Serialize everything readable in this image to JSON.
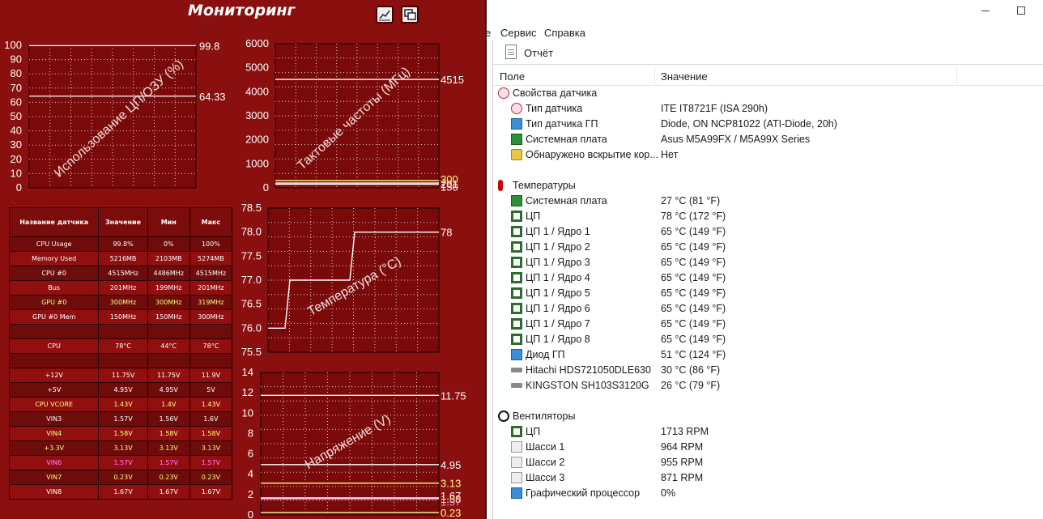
{
  "monitor": {
    "title": "Мониторинг",
    "charts": {
      "usage": {
        "title": "Использование ЦП/ОЗУ (%)",
        "yticks": [
          "100",
          "90",
          "80",
          "70",
          "60",
          "50",
          "40",
          "30",
          "20",
          "10",
          "0"
        ],
        "ymax": 100,
        "series": [
          {
            "name": "CPU Usage",
            "value_label": "99.8",
            "value": 99.8
          },
          {
            "name": "Memory Used",
            "value_label": "64.33",
            "value": 64.33
          }
        ]
      },
      "freq": {
        "title": "Тактовые частоты (МГц)",
        "yticks": [
          "6000",
          "5000",
          "4000",
          "3000",
          "2000",
          "1000",
          "0"
        ],
        "ymax": 6000,
        "labels": [
          "4515",
          "300",
          "201",
          "150"
        ],
        "values": [
          4515,
          300,
          201,
          150
        ]
      },
      "temp": {
        "title": "Температура (°C)",
        "yticks": [
          "78.5",
          "78.0",
          "77.5",
          "77.0",
          "76.5",
          "76.0",
          "75.5"
        ],
        "ymin": 75.5,
        "ymax": 78.5,
        "label": "78",
        "values": [
          76,
          76,
          77,
          77,
          77,
          78,
          78,
          78,
          78,
          78
        ]
      },
      "volt": {
        "title": "Напряжение (V)",
        "yticks": [
          "14",
          "12",
          "10",
          "8",
          "6",
          "4",
          "2",
          "0"
        ],
        "ymax": 14,
        "labels": [
          "11.75",
          "4.95",
          "3.13",
          "1.67",
          "1.58",
          "1.57",
          "0.23"
        ],
        "values": [
          11.75,
          4.95,
          3.13,
          1.67,
          1.58,
          1.57,
          0.23
        ]
      }
    },
    "table": {
      "headers": [
        "Название датчика",
        "Значение",
        "Мин",
        "Макс"
      ],
      "rows": [
        [
          "CPU Usage",
          "99.8%",
          "0%",
          "100%"
        ],
        [
          "Memory Used",
          "5216MB",
          "2103MB",
          "5274MB"
        ],
        [
          "CPU #0",
          "4515MHz",
          "4486MHz",
          "4515MHz"
        ],
        [
          "Bus",
          "201MHz",
          "199MHz",
          "201MHz"
        ],
        [
          "GPU #0",
          "300MHz",
          "300MHz",
          "319MHz"
        ],
        [
          "GPU #0 Mem",
          "150MHz",
          "150MHz",
          "300MHz"
        ],
        [
          "",
          "",
          "",
          ""
        ],
        [
          "CPU",
          "78°C",
          "44°C",
          "78°C"
        ],
        [
          "",
          "",
          "",
          ""
        ],
        [
          "+12V",
          "11.75V",
          "11.75V",
          "11.9V"
        ],
        [
          "+5V",
          "4.95V",
          "4.95V",
          "5V"
        ],
        [
          "CPU VCORE",
          "1.43V",
          "1.4V",
          "1.43V"
        ],
        [
          "VIN3",
          "1.57V",
          "1.56V",
          "1.6V"
        ],
        [
          "VIN4",
          "1.58V",
          "1.58V",
          "1.58V"
        ],
        [
          "+3.3V",
          "3.13V",
          "3.13V",
          "3.13V"
        ],
        [
          "VIN6",
          "1.57V",
          "1.57V",
          "1.57V"
        ],
        [
          "VIN7",
          "0.23V",
          "0.23V",
          "0.23V"
        ],
        [
          "VIN8",
          "1.67V",
          "1.67V",
          "1.67V"
        ]
      ],
      "row_colors": [
        "#ffffff",
        "#ffffff",
        "#ffffff",
        "#ffffff",
        "#ffff80",
        "#ffffff",
        "#ffffff",
        "#ffffff",
        "#ffffff",
        "#ffffff",
        "#ffffff",
        "#ffff80",
        "#ffffff",
        "#ffff80",
        "#ffff80",
        "#ff80ff",
        "#ffff80",
        "#ffffff"
      ]
    }
  },
  "window": {
    "menu": [
      "е",
      "Сервис",
      "Справка"
    ],
    "toolbar": {
      "report": "Отчёт"
    },
    "columns": {
      "field": "Поле",
      "value": "Значение"
    },
    "rows": [
      {
        "type": "group",
        "icon": "gauge-icon",
        "name": "Свойства датчика",
        "value": ""
      },
      {
        "type": "item",
        "icon": "gauge-icon",
        "name": "Тип датчика",
        "value": "ITE IT8721F  (ISA 290h)"
      },
      {
        "type": "item",
        "icon": "monitor-icon",
        "name": "Тип датчика ГП",
        "value": "Diode, ON NCP81022  (ATI-Diode, 20h)"
      },
      {
        "type": "item",
        "icon": "motherboard-icon",
        "name": "Системная плата",
        "value": "Asus M5A99FX / M5A99X Series"
      },
      {
        "type": "item",
        "icon": "lock-icon",
        "name": "Обнаружено вскрытие кор...",
        "value": "Нет"
      },
      {
        "type": "spacer"
      },
      {
        "type": "group",
        "icon": "thermometer-icon",
        "name": "Температуры",
        "value": ""
      },
      {
        "type": "item",
        "icon": "motherboard-icon",
        "name": "Системная плата",
        "value": "27 °C  (81 °F)"
      },
      {
        "type": "item",
        "icon": "chip-icon",
        "name": "ЦП",
        "value": "78 °C  (172 °F)"
      },
      {
        "type": "item",
        "icon": "chip-icon",
        "name": "ЦП 1 / Ядро 1",
        "value": "65 °C  (149 °F)"
      },
      {
        "type": "item",
        "icon": "chip-icon",
        "name": "ЦП 1 / Ядро 2",
        "value": "65 °C  (149 °F)"
      },
      {
        "type": "item",
        "icon": "chip-icon",
        "name": "ЦП 1 / Ядро 3",
        "value": "65 °C  (149 °F)"
      },
      {
        "type": "item",
        "icon": "chip-icon",
        "name": "ЦП 1 / Ядро 4",
        "value": "65 °C  (149 °F)"
      },
      {
        "type": "item",
        "icon": "chip-icon",
        "name": "ЦП 1 / Ядро 5",
        "value": "65 °C  (149 °F)"
      },
      {
        "type": "item",
        "icon": "chip-icon",
        "name": "ЦП 1 / Ядро 6",
        "value": "65 °C  (149 °F)"
      },
      {
        "type": "item",
        "icon": "chip-icon",
        "name": "ЦП 1 / Ядро 7",
        "value": "65 °C  (149 °F)"
      },
      {
        "type": "item",
        "icon": "chip-icon",
        "name": "ЦП 1 / Ядро 8",
        "value": "65 °C  (149 °F)"
      },
      {
        "type": "item",
        "icon": "monitor-icon",
        "name": "Диод ГП",
        "value": "51 °C  (124 °F)"
      },
      {
        "type": "item",
        "icon": "hdd-icon",
        "name": "Hitachi HDS721050DLE630",
        "value": "30 °C  (86 °F)"
      },
      {
        "type": "item",
        "icon": "hdd-icon",
        "name": "KINGSTON SH103S3120G",
        "value": "26 °C  (79 °F)"
      },
      {
        "type": "spacer"
      },
      {
        "type": "group",
        "icon": "fan-icon",
        "name": "Вентиляторы",
        "value": ""
      },
      {
        "type": "item",
        "icon": "chip-icon",
        "name": "ЦП",
        "value": "1713 RPM"
      },
      {
        "type": "item",
        "icon": "case-icon",
        "name": "Шасси 1",
        "value": "964 RPM"
      },
      {
        "type": "item",
        "icon": "case-icon",
        "name": "Шасси 2",
        "value": "955 RPM"
      },
      {
        "type": "item",
        "icon": "case-icon",
        "name": "Шасси 3",
        "value": "871 RPM"
      },
      {
        "type": "item",
        "icon": "monitor-icon",
        "name": "Графический процессор",
        "value": "0%"
      }
    ]
  }
}
